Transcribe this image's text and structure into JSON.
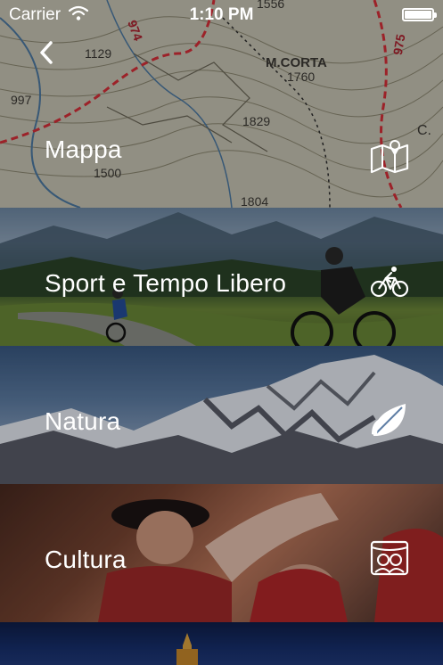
{
  "status_bar": {
    "carrier": "Carrier",
    "time": "1:10 PM"
  },
  "nav": {
    "back_icon": "chevron-left-icon"
  },
  "menu": {
    "items": [
      {
        "label": "Mappa",
        "icon": "map-pin-icon"
      },
      {
        "label": "Sport e Tempo Libero",
        "icon": "bicycle-icon"
      },
      {
        "label": "Natura",
        "icon": "leaf-icon"
      },
      {
        "label": "Cultura",
        "icon": "theater-masks-icon"
      }
    ]
  },
  "map_labels": {
    "peak_name": "M.CORTA",
    "peak_height": "1760",
    "h1": "1129",
    "h2": "997",
    "h3": "1829",
    "h4": "1500",
    "h5": "1804",
    "h6": "1556",
    "road_a": "974",
    "road_b": "975",
    "letter_c": "C."
  },
  "colors": {
    "text": "#ffffff",
    "overlay": "rgba(0,0,0,0.28)",
    "map_route": "#d9303a"
  }
}
